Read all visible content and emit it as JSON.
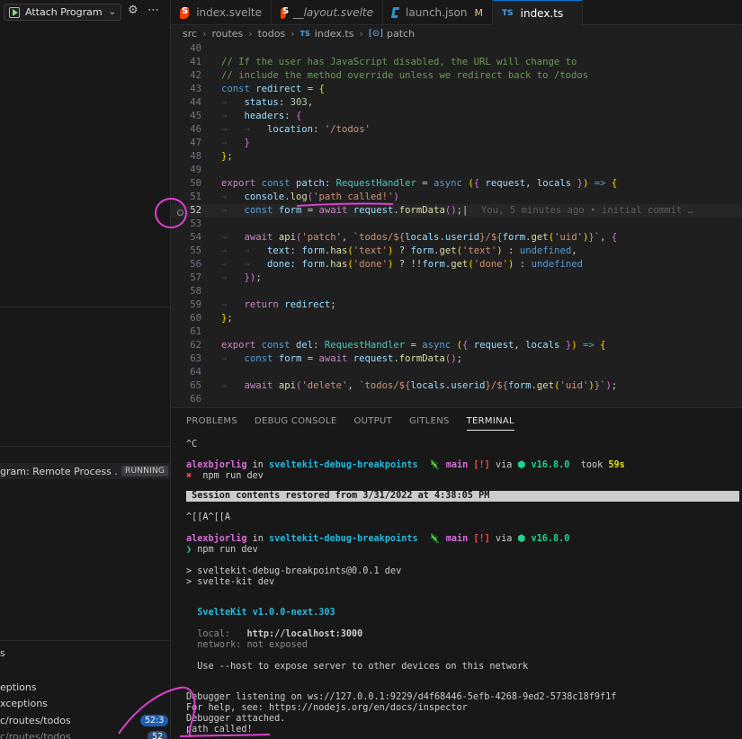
{
  "sidebar": {
    "config_label": "Attach Program",
    "process_name": "gram: Remote Process ...",
    "process_status": "RUNNING",
    "section_label": "s",
    "items": [
      {
        "label": "eptions"
      },
      {
        "label": "xceptions"
      },
      {
        "label": "c/routes/todos",
        "badge": "52:3"
      },
      {
        "label": "c/routes/todos",
        "badge": "52"
      }
    ]
  },
  "tabs": [
    {
      "label": "index.svelte",
      "icon": "svelte-icon",
      "active": false
    },
    {
      "label": "__layout.svelte",
      "icon": "svelte-icon",
      "active": false
    },
    {
      "label": "launch.json",
      "icon": "vscode-icon",
      "modified": "M",
      "active": false
    },
    {
      "label": "index.ts",
      "icon": "ts-icon",
      "active": true
    }
  ],
  "breadcrumb": {
    "parts": [
      "src",
      "routes",
      "todos",
      "index.ts",
      "patch"
    ],
    "ts_badge": "TS"
  },
  "editor": {
    "current_line": 52,
    "blame": "You, 5 minutes ago • initial commit …",
    "lines": [
      {
        "n": 40,
        "html": ""
      },
      {
        "n": 41,
        "html": "<span class=\"c\">// If the user has JavaScript disabled, the URL will change to</span>"
      },
      {
        "n": 42,
        "html": "<span class=\"c\">// include the method override unless we redirect back to /todos</span>"
      },
      {
        "n": 43,
        "html": "<span class=\"k\">const</span> <span class=\"v\">redirect</span> = <span class=\"y\">{</span>"
      },
      {
        "n": 44,
        "html": "<span class=\"ws\">→</span>   <span class=\"v\">status</span>: <span class=\"n\">303</span>,"
      },
      {
        "n": 45,
        "html": "<span class=\"ws\">→</span>   <span class=\"v\">headers</span>: <span class=\"p\">{</span>"
      },
      {
        "n": 46,
        "html": "<span class=\"ws\">→   →</span>   <span class=\"v\">location</span>: <span class=\"s\">'/todos'</span>"
      },
      {
        "n": 47,
        "html": "<span class=\"ws\">→</span>   <span class=\"p\">}</span>"
      },
      {
        "n": 48,
        "html": "<span class=\"y\">}</span>;"
      },
      {
        "n": 49,
        "html": ""
      },
      {
        "n": 50,
        "html": "<span class=\"kc\">export</span> <span class=\"k\">const</span> <span class=\"v\">patch</span>: <span class=\"t\">RequestHandler</span> = <span class=\"k\">async</span> <span class=\"y\">(</span><span class=\"p\">{</span> <span class=\"v\">request</span>, <span class=\"v\">locals</span> <span class=\"p\">}</span><span class=\"y\">)</span> <span class=\"k\">=&gt;</span> <span class=\"y\">{</span>"
      },
      {
        "n": 51,
        "html": "<span class=\"ws\">→</span>   <span class=\"v\">console</span>.<span class=\"f\">log</span><span class=\"p\">(</span><span class=\"s\">'path called!'</span><span class=\"p\">)</span>"
      },
      {
        "n": 52,
        "html": "<span class=\"ws\">→</span>   <span class=\"k\">const</span> <span class=\"v\">form</span> = <span class=\"kc\">await</span> <span class=\"v\">request</span>.<span class=\"f\">formData</span><span class=\"p\">()</span>;|"
      },
      {
        "n": 53,
        "html": ""
      },
      {
        "n": 54,
        "html": "<span class=\"ws\">→</span>   <span class=\"kc\">await</span> <span class=\"f\">api</span><span class=\"p\">(</span><span class=\"s\">'patch'</span>, <span class=\"s\">`todos/${</span><span class=\"v\">locals</span>.<span class=\"v\">userid</span><span class=\"s\">}/${</span><span class=\"v\">form</span>.<span class=\"f\">get</span><span class=\"y\">(</span><span class=\"s\">'uid'</span><span class=\"y\">)</span><span class=\"s\">}`</span>, <span class=\"p\">{</span>"
      },
      {
        "n": 55,
        "html": "<span class=\"ws\">→   →</span>   <span class=\"v\">text</span>: <span class=\"v\">form</span>.<span class=\"f\">has</span><span class=\"y\">(</span><span class=\"s\">'text'</span><span class=\"y\">)</span> ? <span class=\"v\">form</span>.<span class=\"f\">get</span><span class=\"y\">(</span><span class=\"s\">'text'</span><span class=\"y\">)</span> : <span class=\"k\">undefined</span>,"
      },
      {
        "n": 56,
        "html": "<span class=\"ws\">→   →</span>   <span class=\"v\">done</span>: <span class=\"v\">form</span>.<span class=\"f\">has</span><span class=\"y\">(</span><span class=\"s\">'done'</span><span class=\"y\">)</span> ? !!<span class=\"v\">form</span>.<span class=\"f\">get</span><span class=\"y\">(</span><span class=\"s\">'done'</span><span class=\"y\">)</span> : <span class=\"k\">undefined</span>"
      },
      {
        "n": 57,
        "html": "<span class=\"ws\">→</span>   <span class=\"p\">}</span><span class=\"p\">)</span>;"
      },
      {
        "n": 58,
        "html": ""
      },
      {
        "n": 59,
        "html": "<span class=\"ws\">→</span>   <span class=\"kc\">return</span> <span class=\"v\">redirect</span>;"
      },
      {
        "n": 60,
        "html": "<span class=\"y\">}</span>;"
      },
      {
        "n": 61,
        "html": ""
      },
      {
        "n": 62,
        "html": "<span class=\"kc\">export</span> <span class=\"k\">const</span> <span class=\"v\">del</span>: <span class=\"t\">RequestHandler</span> = <span class=\"k\">async</span> <span class=\"y\">(</span><span class=\"p\">{</span> <span class=\"v\">request</span>, <span class=\"v\">locals</span> <span class=\"p\">}</span><span class=\"y\">)</span> <span class=\"k\">=&gt;</span> <span class=\"y\">{</span>"
      },
      {
        "n": 63,
        "html": "<span class=\"ws\">→</span>   <span class=\"k\">const</span> <span class=\"v\">form</span> = <span class=\"kc\">await</span> <span class=\"v\">request</span>.<span class=\"f\">formData</span><span class=\"p\">()</span>;"
      },
      {
        "n": 64,
        "html": ""
      },
      {
        "n": 65,
        "html": "<span class=\"ws\">→</span>   <span class=\"kc\">await</span> <span class=\"f\">api</span><span class=\"p\">(</span><span class=\"s\">'delete'</span>, <span class=\"s\">`todos/${</span><span class=\"v\">locals</span>.<span class=\"v\">userid</span><span class=\"s\">}/${</span><span class=\"v\">form</span>.<span class=\"f\">get</span><span class=\"y\">(</span><span class=\"s\">'uid'</span><span class=\"y\">)</span><span class=\"s\">}`</span><span class=\"p\">)</span>;"
      },
      {
        "n": 66,
        "html": ""
      }
    ]
  },
  "panel": {
    "tabs": [
      "PROBLEMS",
      "DEBUG CONSOLE",
      "OUTPUT",
      "GITLENS",
      "TERMINAL"
    ],
    "active_tab": "TERMINAL"
  },
  "terminal": {
    "lines": [
      {
        "html": "^C"
      },
      {
        "html": "<span class=\"tmag\">alexbjorlig</span> in <span class=\"tcy\">sveltekit-debug-breakpoints</span>  🦎 <span class=\"tmag\">main</span> <span class=\"tred tb\">[!]</span> via <span class=\"tgr\">⬢ v16.8.0</span>  took <span class=\"tye\">59s</span>"
      },
      {
        "html": "<span class=\"tred tb\">✖</span>  npm run dev"
      },
      {
        "html": ""
      },
      {
        "html": "^[[A^[[A"
      },
      {
        "html": "<span class=\"tmag\">alexbjorlig</span> in <span class=\"tcy\">sveltekit-debug-breakpoints</span>  🦎 <span class=\"tmag\">main</span> <span class=\"tred tb\">[!]</span> via <span class=\"tgr\">⬢ v16.8.0</span>"
      },
      {
        "html": "<span class=\"tgr\">❯</span> npm run dev"
      },
      {
        "html": "&gt; sveltekit-debug-breakpoints@0.0.1 dev"
      },
      {
        "html": "&gt; svelte-kit dev"
      },
      {
        "html": "  <span class=\"tcy\">SvelteKit v1.0.0-next.303</span>"
      },
      {
        "html": "  <span class=\"tdim\">local:</span>   <span class=\"tb\">http://localhost:3000</span>"
      },
      {
        "html": "  <span class=\"tdim\">network: not exposed</span>"
      },
      {
        "html": "  Use --host to expose server to other devices on this network"
      },
      {
        "html": "Debugger listening on ws://127.0.0.1:9229/d4f68446-5efb-4268-9ed2-5738c18f9f1f"
      },
      {
        "html": "For help, see: https://nodejs.org/en/docs/inspector"
      },
      {
        "html": "Debugger attached."
      },
      {
        "html": "path called!"
      }
    ],
    "restored": " Session contents restored from 3/31/2022 at 4:38:05 PM"
  },
  "colors": {
    "accent": "#0078d4",
    "annotation": "#e040d0"
  }
}
